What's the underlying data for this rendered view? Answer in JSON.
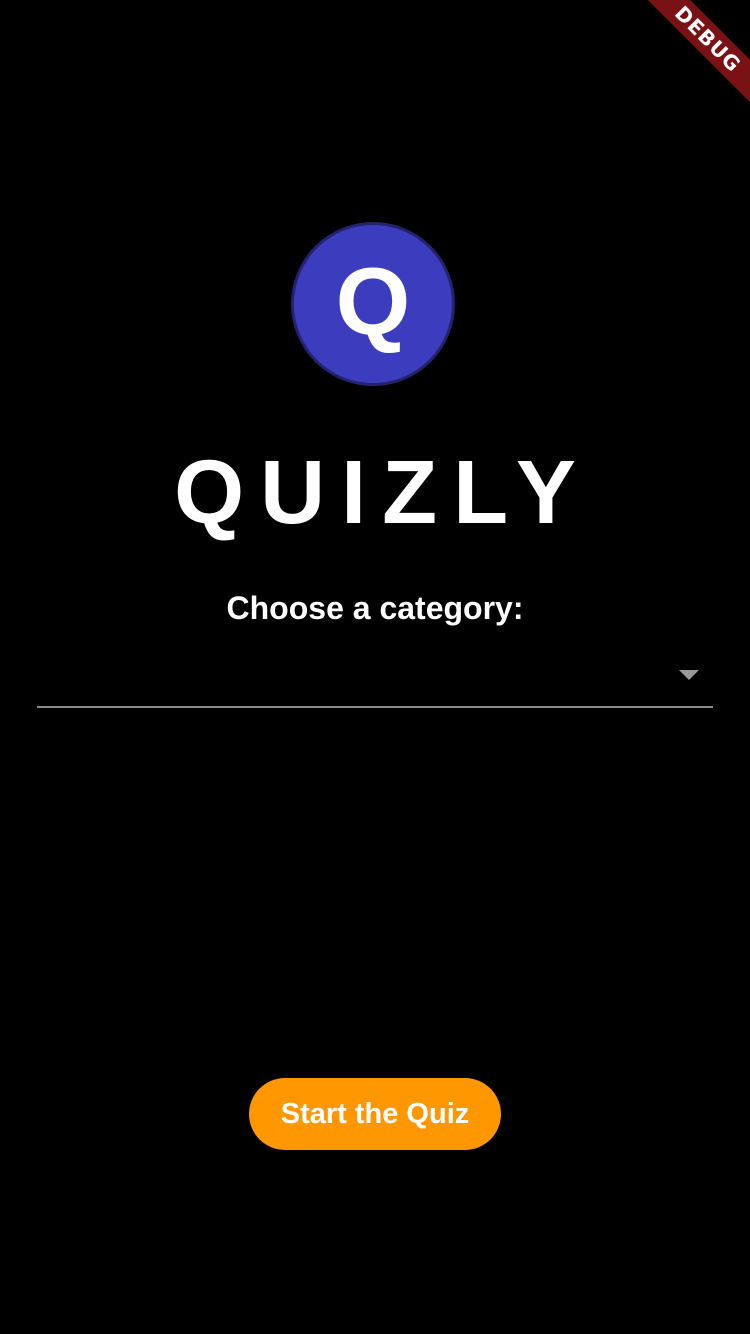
{
  "debug_banner": {
    "label": "DEBUG",
    "color": "#7a1115"
  },
  "logo": {
    "letter": "Q",
    "background_color": "#3c3dbe",
    "border_color": "#23236e"
  },
  "app": {
    "title": "QUIZLY"
  },
  "category": {
    "label": "Choose a category:",
    "selected_value": ""
  },
  "start_button": {
    "label": "Start the Quiz",
    "color": "#ff9800"
  }
}
